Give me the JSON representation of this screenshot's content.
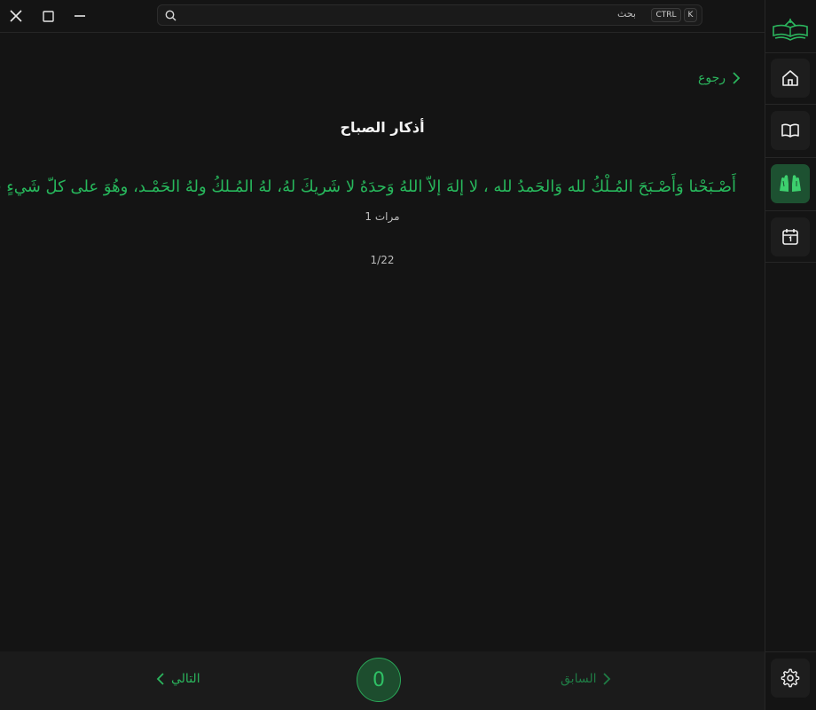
{
  "titlebar": {
    "window_controls": [
      "close-icon",
      "maximize-icon",
      "minimize-icon"
    ],
    "search": {
      "placeholder": "بحث",
      "shortcut_ctrl": "CTRL",
      "shortcut_key": "K"
    }
  },
  "sidebar": {
    "items": [
      {
        "name": "home",
        "icon": "home-icon",
        "active": false
      },
      {
        "name": "quran",
        "icon": "open-book-icon",
        "active": false
      },
      {
        "name": "adhkar",
        "icon": "praying-hands-icon",
        "active": true
      },
      {
        "name": "calendar",
        "icon": "calendar-icon",
        "active": false
      }
    ],
    "settings_icon": "gear-icon"
  },
  "content": {
    "back_label": "رجوع",
    "title": "أذكار الصباح",
    "dhikr_text": "أَصْـبَحْنا وَأَصْـبَحَ المُـلْكُ لله وَالحَمدُ لله ، لا إلهَ إلاّ اللهُ وَحدَهُ لا شَريكَ لهُ، لهُ المُـلكُ ولهُ الحَمْـد، وهُوَ على كلّ شَيءٍ قدير",
    "repeat_text": "1 مرات",
    "progress_text": "1/22"
  },
  "footer": {
    "next_label": "التالي",
    "previous_label": "السابق",
    "counter_value": "0"
  },
  "colors": {
    "accent": "#2bb55d",
    "background": "#141414",
    "footer_background": "#1b1b1b",
    "active_sidebar": "#1d5131"
  }
}
